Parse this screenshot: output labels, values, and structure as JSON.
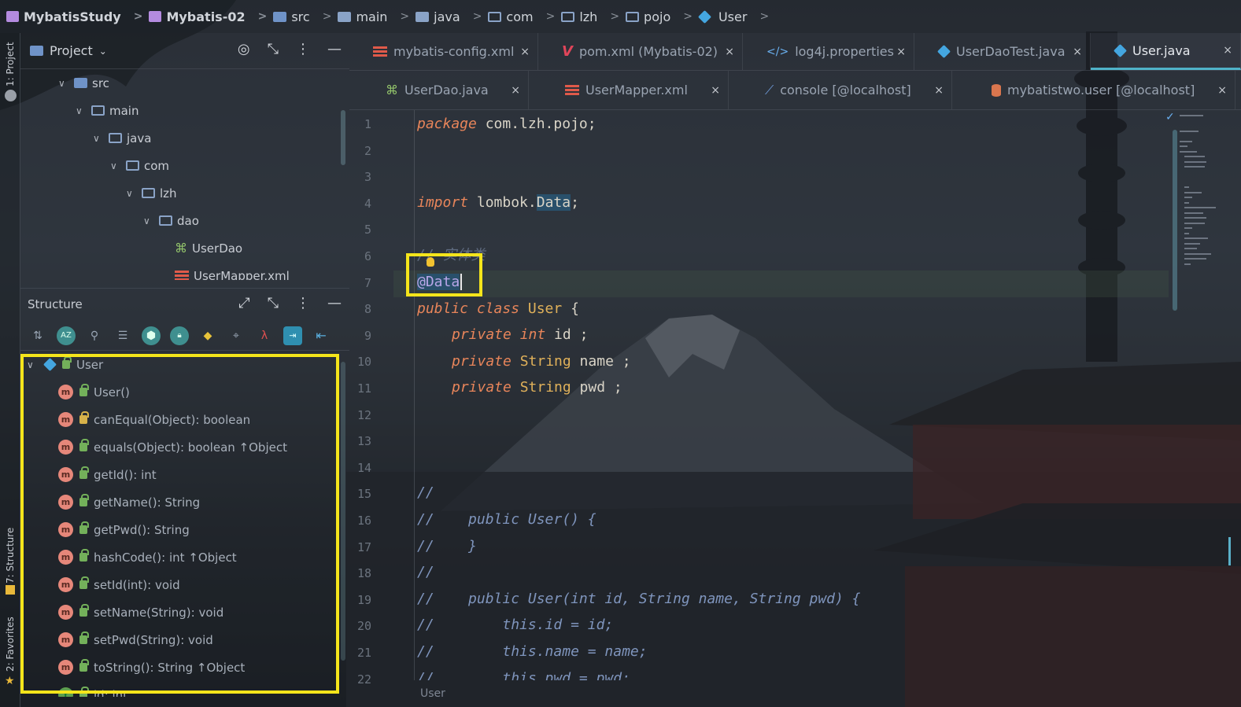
{
  "breadcrumb": {
    "items": [
      "MybatisStudy",
      "Mybatis-02",
      "src",
      "main",
      "java",
      "com",
      "lzh",
      "pojo",
      "User"
    ]
  },
  "toolstrip": {
    "project_label": "1: Project",
    "structure_label": "7: Structure",
    "favorites_label": "2: Favorites"
  },
  "project_panel": {
    "title": "Project",
    "tree": [
      {
        "label": "src",
        "depth": 0
      },
      {
        "label": "main",
        "depth": 1
      },
      {
        "label": "java",
        "depth": 2
      },
      {
        "label": "com",
        "depth": 3
      },
      {
        "label": "lzh",
        "depth": 4
      },
      {
        "label": "dao",
        "depth": 5
      },
      {
        "label": "UserDao",
        "depth": 6
      },
      {
        "label": "UserMapper.xml",
        "depth": 6
      }
    ]
  },
  "structure_panel": {
    "title": "Structure",
    "root": "User",
    "members": [
      {
        "label": "User()",
        "lock": "green"
      },
      {
        "label": "canEqual(Object): boolean",
        "lock": "yellow"
      },
      {
        "label": "equals(Object): boolean ↑Object",
        "lock": "green"
      },
      {
        "label": "getId(): int",
        "lock": "green"
      },
      {
        "label": "getName(): String",
        "lock": "green"
      },
      {
        "label": "getPwd(): String",
        "lock": "green"
      },
      {
        "label": "hashCode(): int ↑Object",
        "lock": "green"
      },
      {
        "label": "setId(int): void",
        "lock": "green"
      },
      {
        "label": "setName(String): void",
        "lock": "green"
      },
      {
        "label": "setPwd(String): void",
        "lock": "green"
      },
      {
        "label": "toString(): String ↑Object",
        "lock": "green"
      },
      {
        "label": "id: int",
        "lock": "green"
      }
    ]
  },
  "tabs_row1": [
    {
      "label": "mybatis-config.xml",
      "icon": "xml-icon",
      "active": false
    },
    {
      "label": "pom.xml (Mybatis-02)",
      "icon": "maven-icon",
      "active": false
    },
    {
      "label": "log4j.properties",
      "icon": "properties-icon",
      "active": false
    },
    {
      "label": "UserDaoTest.java",
      "icon": "class-icon",
      "active": false
    },
    {
      "label": "User.java",
      "icon": "class-icon",
      "active": true
    }
  ],
  "tabs_row2": [
    {
      "label": "UserDao.java",
      "icon": "interface-icon"
    },
    {
      "label": "UserMapper.xml",
      "icon": "xml-icon"
    },
    {
      "label": "console [@localhost]",
      "icon": "console-icon"
    },
    {
      "label": "mybatistwo.user [@localhost]",
      "icon": "table-icon"
    }
  ],
  "editor": {
    "line_numbers": [
      "1",
      "2",
      "3",
      "4",
      "5",
      "6",
      "7",
      "8",
      "9",
      "10",
      "11",
      "12",
      "13",
      "14",
      "15",
      "16",
      "17",
      "18",
      "19",
      "20",
      "21",
      "22"
    ],
    "lines": {
      "l1_kw": "package",
      "l1_rest": " com.lzh.pojo;",
      "l4_kw": "import",
      "l4_rest": " lombok.",
      "l4_hl": "Data",
      "l4_end": ";",
      "l6": "// 实体类",
      "l7": "@Data",
      "l8_kw": "public class",
      "l8_cls": " User",
      "l8_end": " {",
      "l9_kw": "private",
      "l9_ty": " int",
      "l9_rest": " id ;",
      "l10_kw": "private",
      "l10_ty": " String",
      "l10_rest": " name ;",
      "l11_kw": "private",
      "l11_ty": " String",
      "l11_rest": " pwd ;",
      "l15": "//",
      "l16": "//    public User() {",
      "l17": "//    }",
      "l18": "//",
      "l19": "//    public User(int id, String name, String pwd) {",
      "l20": "//        this.id = id;",
      "l21": "//        this.name = name;",
      "l22": "//        this.pwd = pwd;"
    }
  },
  "status": {
    "text": "User"
  },
  "colors": {
    "highlight": "#f5e51b",
    "accent": "#4fb3c9"
  }
}
